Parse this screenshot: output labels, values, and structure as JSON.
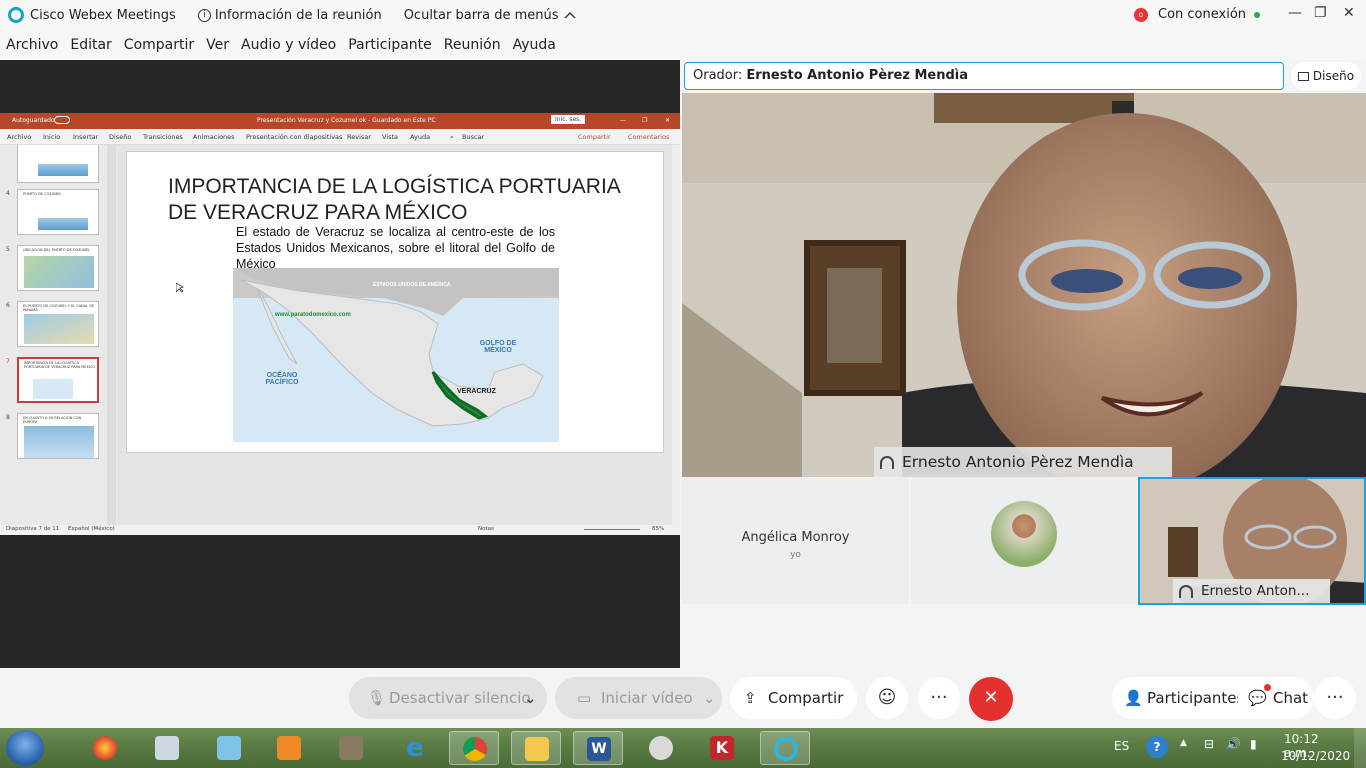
{
  "titlebar": {
    "app_title": "Cisco Webex Meetings",
    "info_label": "Información de la reunión",
    "hide_menu_label": "Ocultar barra de menús",
    "connection_status": "Con conexión",
    "icons": [
      "webex-logo-icon",
      "info-icon",
      "chevron-up-icon",
      "recording-icon",
      "status-dot-icon"
    ]
  },
  "menubar": {
    "items": [
      "Archivo",
      "Editar",
      "Compartir",
      "Ver",
      "Audio y vídeo",
      "Participante",
      "Reunión",
      "Ayuda"
    ]
  },
  "powerpoint": {
    "autosave": "Autoguardado",
    "window_title": "Presentación Veracruz y Cozumel ok - Guardado en Este PC",
    "signin": "Inic. ses.",
    "ribbon_tabs": [
      "Archivo",
      "Inicio",
      "Insertar",
      "Diseño",
      "Transiciones",
      "Animaciones",
      "Presentación con diapositivas",
      "Revisar",
      "Vista",
      "Ayuda"
    ],
    "search": "Buscar",
    "share": "Compartir",
    "comments": "Comentarios",
    "thumbnails": [
      {
        "num": "4",
        "title": "PUERTO DE COZUMEL"
      },
      {
        "num": "5",
        "title": "UBICACIÓN DEL PUERTO DE COZUMEL"
      },
      {
        "num": "6",
        "title": "EL PUERTO DE COZUMEL Y EL CANAL DE PANAMÁ"
      },
      {
        "num": "7",
        "title": "IMPORTANCIA DE LA LOGÍSTICA PORTUARIA DE VERACRUZ PARA MÉXICO"
      },
      {
        "num": "8",
        "title": "EN CUANTO A SU RELACIÓN CON EUROPA"
      }
    ],
    "slide": {
      "title": "IMPORTANCIA DE LA LOGÍSTICA PORTUARIA DE VERACRUZ PARA MÉXICO",
      "body": "El estado de Veracruz se localiza al centro-este de los Estados Unidos Mexicanos, sobre el litoral del Golfo de México",
      "map_labels": {
        "usa": "ESTADOS UNIDOS DE AMÉRICA",
        "website": "www.paratodomexico.com",
        "gulf": "GOLFO DE MÉXICO",
        "pacific": "OCÉANO PACÍFICO",
        "veracruz": "VERACRUZ"
      }
    },
    "status": {
      "slide_counter": "Diapositiva 7 de 11",
      "language": "Español (México)",
      "notes": "Notas",
      "zoom": "85%"
    }
  },
  "right_panel": {
    "speaker_prefix": "Orador:",
    "speaker_name": "Ernesto Antonio Pèrez Mendìa",
    "layout_button": "Diseño",
    "active_video_label": "Ernesto Antonio Pèrez Mendìa",
    "participant_tiles": [
      {
        "name": "Angélica Monroy",
        "sub": "yo"
      },
      {
        "name": ""
      },
      {
        "name": "Ernesto Anton..."
      }
    ]
  },
  "controls": {
    "mute": "Desactivar silencio",
    "video": "Iniciar vídeo",
    "share": "Compartir",
    "participants": "Participantes",
    "chat": "Chat",
    "accent_end_color": "#e2312f"
  },
  "taskbar": {
    "language": "ES",
    "time": "10:12 a.m.",
    "date": "10/12/2020",
    "apps": [
      "firefox-icon",
      "calculator-icon",
      "notepad-icon",
      "media-player-icon",
      "gimp-icon",
      "internet-explorer-icon",
      "chrome-icon",
      "file-explorer-icon",
      "word-icon",
      "paint-icon",
      "kaspersky-icon",
      "webex-icon"
    ]
  }
}
